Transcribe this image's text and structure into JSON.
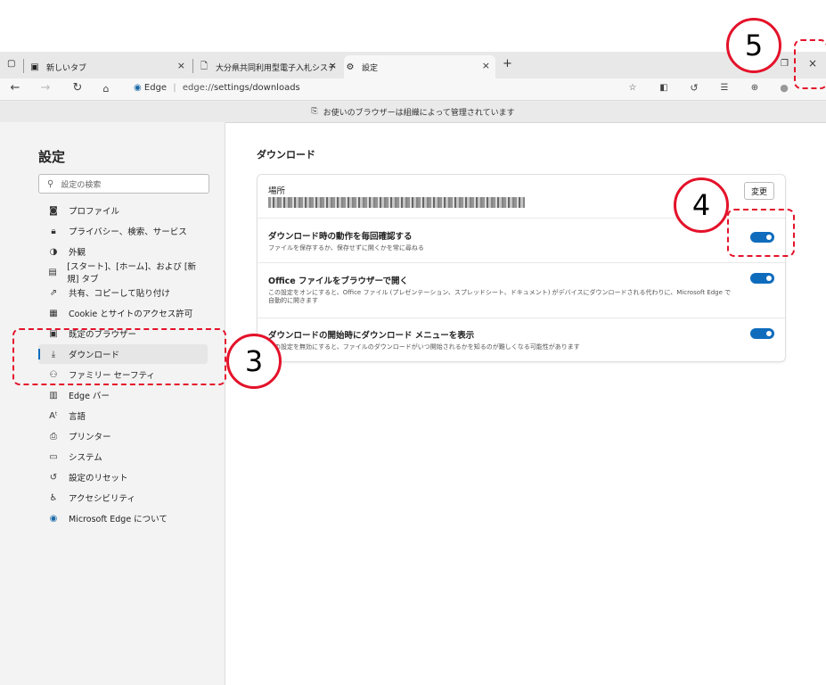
{
  "tabs": [
    {
      "icon": "new-tab-icon",
      "label": "新しいタブ"
    },
    {
      "icon": "document-icon",
      "label": "大分県共同利用型電子入札システ"
    },
    {
      "icon": "gear-icon",
      "label": "設定"
    }
  ],
  "tab_close": "×",
  "new_tab": "+",
  "window_close": "×",
  "address": {
    "site": "Edge",
    "url_prefix": "edge://",
    "url_rest": "settings/downloads"
  },
  "managed_message": "お使いのブラウザーは組織によって管理されています",
  "sidebar": {
    "title": "設定",
    "search_placeholder": "設定の検索",
    "items": [
      {
        "icon": "profile-icon",
        "label": "プロファイル"
      },
      {
        "icon": "lock-icon",
        "label": "プライバシー、検索、サービス"
      },
      {
        "icon": "appearance-icon",
        "label": "外観"
      },
      {
        "icon": "start-page-icon",
        "label": "[スタート]、[ホーム]、および [新規] タブ"
      },
      {
        "icon": "share-icon",
        "label": "共有、コピーして貼り付け"
      },
      {
        "icon": "cookie-icon",
        "label": "Cookie とサイトのアクセス許可"
      },
      {
        "icon": "default-browser-icon",
        "label": "既定のブラウザー"
      },
      {
        "icon": "download-icon",
        "label": "ダウンロード"
      },
      {
        "icon": "family-icon",
        "label": "ファミリー セーフティ"
      },
      {
        "icon": "edge-bar-icon",
        "label": "Edge バー"
      },
      {
        "icon": "language-icon",
        "label": "言語"
      },
      {
        "icon": "printer-icon",
        "label": "プリンター"
      },
      {
        "icon": "system-icon",
        "label": "システム"
      },
      {
        "icon": "reset-icon",
        "label": "設定のリセット"
      },
      {
        "icon": "accessibility-icon",
        "label": "アクセシビリティ"
      },
      {
        "icon": "edge-logo-icon",
        "label": "Microsoft Edge について"
      }
    ]
  },
  "main": {
    "title": "ダウンロード",
    "location_label": "場所",
    "change_button": "変更",
    "settings": [
      {
        "title": "ダウンロード時の動作を毎回確認する",
        "desc": "ファイルを保存するか、保存せずに開くかを常に尋ねる",
        "enabled": true
      },
      {
        "title": "Office ファイルをブラウザーで開く",
        "desc": "この設定をオンにすると、Office ファイル (プレゼンテーション、スプレッドシート、ドキュメント) がデバイスにダウンロードされる代わりに、Microsoft Edge で自動的に開きます",
        "enabled": true
      },
      {
        "title": "ダウンロードの開始時にダウンロード メニューを表示",
        "desc": "この設定を無効にすると、ファイルのダウンロードがいつ開始されるかを知るのが難しくなる可能性があります",
        "enabled": true
      }
    ]
  },
  "annotations": {
    "three": "3",
    "four": "4",
    "five": "5"
  },
  "colors": {
    "accent": "#0f6cbd",
    "annotation": "#e4122a"
  }
}
